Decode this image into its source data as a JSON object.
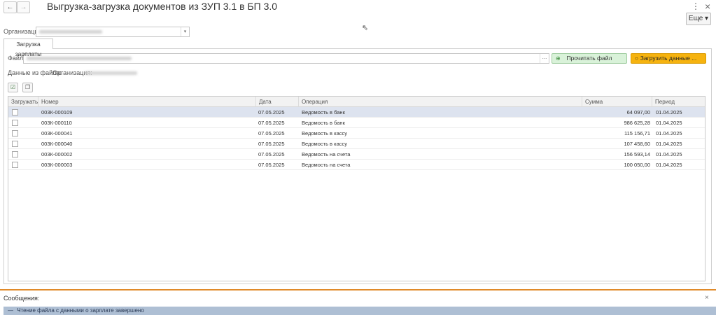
{
  "window": {
    "title": "Выгрузка-загрузка документов из ЗУП 3.1 в БП 3.0",
    "back_glyph": "←",
    "forward_glyph": "→",
    "menu_glyph": "⋮",
    "close_glyph": "×",
    "more_label": "Еще ▾"
  },
  "org": {
    "label": "Организация:",
    "drop_glyph": "▾"
  },
  "tabs": [
    {
      "label": "Загрузка зарплаты"
    }
  ],
  "file": {
    "label": "Файл:",
    "browse_glyph": "...",
    "read_button": "Прочитать файл",
    "load_button": "Загрузить данные ..."
  },
  "file_data": {
    "label": "Данные из файла:",
    "org_label": "Организация:"
  },
  "grid": {
    "columns": [
      "Загружать",
      "Номер",
      "Дата",
      "Операция",
      "Сумма",
      "Период регистрации"
    ],
    "rows": [
      {
        "number": "003К-000109",
        "date": "07.05.2025",
        "operation": "Ведомость в банк",
        "sum": "64 097,00",
        "period": "01.04.2025",
        "selected": true
      },
      {
        "number": "003К-000110",
        "date": "07.05.2025",
        "operation": "Ведомость в банк",
        "sum": "986 625,28",
        "period": "01.04.2025",
        "selected": false
      },
      {
        "number": "003К-000041",
        "date": "07.05.2025",
        "operation": "Ведомость в кассу",
        "sum": "115 156,71",
        "period": "01.04.2025",
        "selected": false
      },
      {
        "number": "003К-000040",
        "date": "07.05.2025",
        "operation": "Ведомость в кассу",
        "sum": "107 458,60",
        "period": "01.04.2025",
        "selected": false
      },
      {
        "number": "003К-000002",
        "date": "07.05.2025",
        "operation": "Ведомость на счета",
        "sum": "156 593,14",
        "period": "01.04.2025",
        "selected": false
      },
      {
        "number": "003К-000003",
        "date": "07.05.2025",
        "operation": "Ведомость на счета",
        "sum": "100 050,00",
        "period": "01.04.2025",
        "selected": false
      }
    ]
  },
  "messages": {
    "header": "Сообщения:",
    "close_glyph": "×",
    "text": "Чтение файла с данными о зарплате завершено"
  },
  "colors": {
    "accent_orange": "#e08a2a",
    "load_button": "#f6b30f",
    "read_button": "#d9f2d9",
    "selected_row": "#dde3ef"
  }
}
